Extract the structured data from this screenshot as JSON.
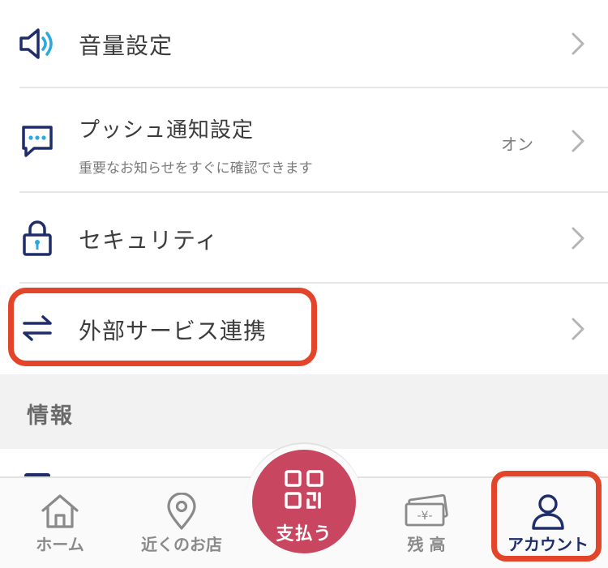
{
  "settings": {
    "volume": {
      "label": "音量設定"
    },
    "push": {
      "label": "プッシュ通知設定",
      "sub": "重要なお知らせをすぐに確認できます",
      "value": "オン"
    },
    "security": {
      "label": "セキュリティ"
    },
    "external": {
      "label": "外部サービス連携"
    }
  },
  "section": {
    "title": "情報"
  },
  "tabbar": {
    "home": "ホーム",
    "nearby": "近くのお店",
    "pay": "支払う",
    "balance": "残 高",
    "account": "アカウント"
  },
  "colors": {
    "icon_navy": "#1f2d6b",
    "icon_blue": "#2aa8e0",
    "pay_button": "#c8465f",
    "highlight": "#e3452a",
    "tab_active": "#1f2d6b",
    "tab_inactive": "#8a8a8a"
  }
}
